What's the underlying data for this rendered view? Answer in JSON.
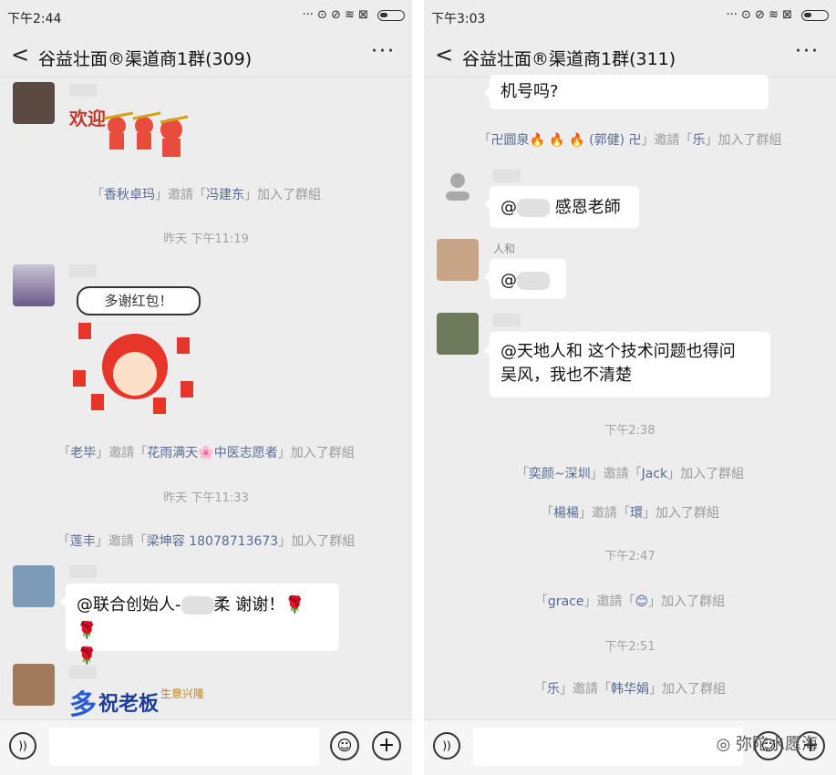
{
  "left": {
    "status": {
      "time": "下午2:44",
      "icons": "··· ⊙ ⊘ ≋ ⊠"
    },
    "title": "谷益壮面®渠道商1群(309)",
    "back": "<",
    "more": "···",
    "welcome_sticker": "欢迎",
    "sys1": {
      "a": "香秋卓玛",
      "verb": "邀請",
      "b": "冯建东",
      "suffix": "加入了群組"
    },
    "ts1": "昨天 下午11:19",
    "thanks_sticker": "多谢红包！",
    "sys2": {
      "a": "老毕",
      "verb": "邀請",
      "b": "花雨满天🌸中医志愿者",
      "suffix": "加入了群組"
    },
    "ts2": "昨天 下午11:33",
    "sys3": {
      "a": "莲丰",
      "verb": "邀請",
      "b": "梁坤容 18078713673",
      "suffix": "加入了群組"
    },
    "msg1": {
      "pre": "@联合创始人-",
      "post": "柔  谢谢！🌹 🌹",
      "line2": "🌹"
    },
    "boss_sticker": {
      "big": "多",
      "main": "祝老板",
      "small": "生意兴隆"
    }
  },
  "right": {
    "status": {
      "time": "下午3:03",
      "icons": "··· ⊙ ⊘ ≋ ⊠"
    },
    "title": "谷益壮面®渠道商1群(311)",
    "back": "<",
    "more": "···",
    "msg0": "机号吗?",
    "sys1": {
      "a": "卍圆泉",
      "fire": "🔥 🔥  🔥",
      "a2": "(郭健) 卍",
      "verb": "邀請",
      "b": "乐",
      "suffix": "加入了群組"
    },
    "msg1": {
      "pre": "@",
      "post": "  感恩老師"
    },
    "nick2": "人和",
    "msg2": {
      "pre": "@"
    },
    "msg3": {
      "line1": "@天地人和  这个技术问题也得问",
      "line2": "吴风，我也不清楚"
    },
    "ts1": "下午2:38",
    "sys2": {
      "a": "奕颜~深圳",
      "verb": "邀請",
      "b": "Jack",
      "suffix": "加入了群組"
    },
    "sys3": {
      "a": "楊楊",
      "verb": "邀請",
      "b": "環",
      "suffix": "加入了群組"
    },
    "ts2": "下午2:47",
    "sys4": {
      "a": "grace",
      "verb": "邀請",
      "b": "😊",
      "suffix": "加入了群組"
    },
    "ts3": "下午2:51",
    "sys5": {
      "a": "乐",
      "verb": "邀請",
      "b": "韩华娟",
      "suffix": "加入了群組"
    },
    "watermark": "弥陀水愿海"
  },
  "colors": {
    "bg": "#ededed",
    "link": "#576b95",
    "system_text": "#9b9b9b"
  }
}
